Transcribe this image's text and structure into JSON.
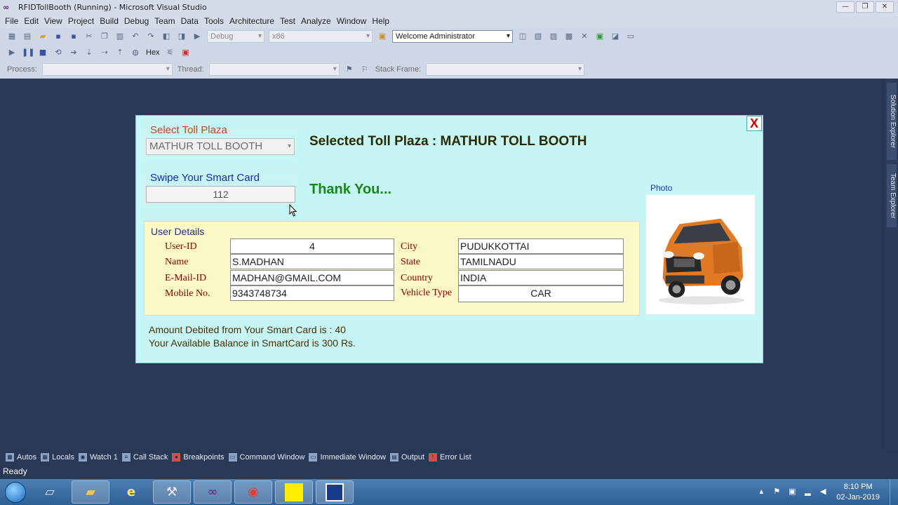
{
  "window": {
    "title": "RFIDTollBooth (Running) - Microsoft Visual Studio",
    "logo_icon": "vs-infinity-icon"
  },
  "menu": [
    "File",
    "Edit",
    "View",
    "Project",
    "Build",
    "Debug",
    "Team",
    "Data",
    "Tools",
    "Architecture",
    "Test",
    "Analyze",
    "Window",
    "Help"
  ],
  "toolbar": {
    "config": "Debug",
    "platform": "x86",
    "user": "Welcome Administrator",
    "hex": "Hex",
    "process_label": "Process:",
    "thread_label": "Thread:",
    "stack_label": "Stack Frame:"
  },
  "dock": {
    "solution_explorer": "Solution Explorer",
    "team_explorer": "Team Explorer"
  },
  "form": {
    "close": "X",
    "toll_label": "Select Toll Plaza",
    "toll_value": "MATHUR TOLL BOOTH",
    "card_label": "Swipe Your Smart Card",
    "card_value": "112",
    "selected_title": "Selected Toll Plaza : MATHUR TOLL BOOTH",
    "thanks": "Thank You...",
    "user_details_label": "User Details",
    "fields": {
      "userid_label": "User-ID",
      "userid": "4",
      "name_label": "Name",
      "name": "S.MADHAN",
      "email_label": "E-Mail-ID",
      "email": "MADHAN@GMAIL.COM",
      "mobile_label": "Mobile No.",
      "mobile": "9343748734",
      "city_label": "City",
      "city": "PUDUKKOTTAI",
      "state_label": "State",
      "state": "TAMILNADU",
      "country_label": "Country",
      "country": "INDIA",
      "vehicle_label": "Vehicle Type",
      "vehicle": "CAR"
    },
    "photo_label": "Photo",
    "amount_line": "Amount Debited from Your Smart Card is : 40",
    "balance_line": "Your Available Balance in SmartCard is 300 Rs."
  },
  "bottom_tabs": [
    "Autos",
    "Locals",
    "Watch 1",
    "Call Stack",
    "Breakpoints",
    "Command Window",
    "Immediate Window",
    "Output",
    "Error List"
  ],
  "status": "Ready",
  "clock": {
    "time": "8:10 PM",
    "date": "02-Jan-2019"
  }
}
